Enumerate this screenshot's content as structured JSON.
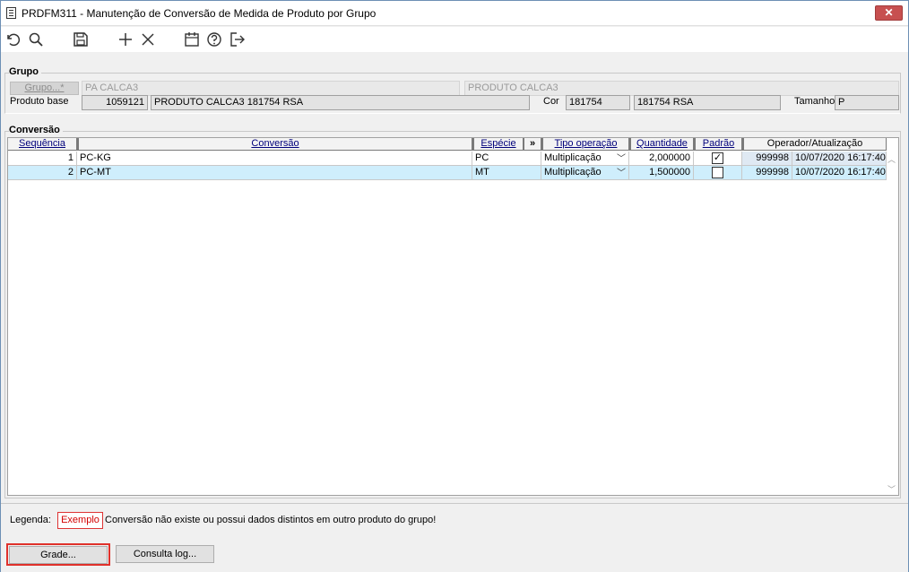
{
  "window": {
    "title": "PRDFM311 - Manutenção de Conversão de Medida de Produto por Grupo",
    "close_label": "✕"
  },
  "toolbar": {
    "icons": [
      "undo-icon",
      "search-icon",
      "save-icon",
      "add-icon",
      "delete-icon",
      "calendar-icon",
      "help-icon",
      "exit-icon"
    ]
  },
  "grupo": {
    "title": "Grupo",
    "grupo_button": "Grupo...*",
    "grupo_code": "PA CALCA3",
    "grupo_desc": "PRODUTO CALCA3",
    "produto_base_label": "Produto base",
    "produto_base_code": "1059121",
    "produto_base_desc": "PRODUTO CALCA3 181754 RSA",
    "cor_label": "Cor",
    "cor_code": "181754",
    "cor_desc": "181754 RSA",
    "tamanho_label": "Tamanho",
    "tamanho_value": "P"
  },
  "conversao": {
    "title": "Conversão",
    "headers": {
      "sequencia": "Sequência",
      "conversao": "Conversão",
      "especie": "Espécie",
      "expand": "»",
      "tipo_operacao": "Tipo operação",
      "quantidade": "Quantidade",
      "padrao": "Padrão",
      "operador": "Operador/Atualização"
    },
    "rows": [
      {
        "seq": "1",
        "conversao": "PC-KG",
        "especie": "PC",
        "tipo": "Multiplicação",
        "quantidade": "2,000000",
        "padrao": true,
        "operador": "999998",
        "atualizacao": "10/07/2020 16:17:40"
      },
      {
        "seq": "2",
        "conversao": "PC-MT",
        "especie": "MT",
        "tipo": "Multiplicação",
        "quantidade": "1,500000",
        "padrao": false,
        "operador": "999998",
        "atualizacao": "10/07/2020 16:17:40"
      }
    ]
  },
  "legend": {
    "label": "Legenda:",
    "example": "Exemplo",
    "text": "Conversão não existe ou possui dados distintos em outro produto do grupo!"
  },
  "buttons": {
    "grade": "Grade...",
    "consulta_log": "Consulta log..."
  }
}
